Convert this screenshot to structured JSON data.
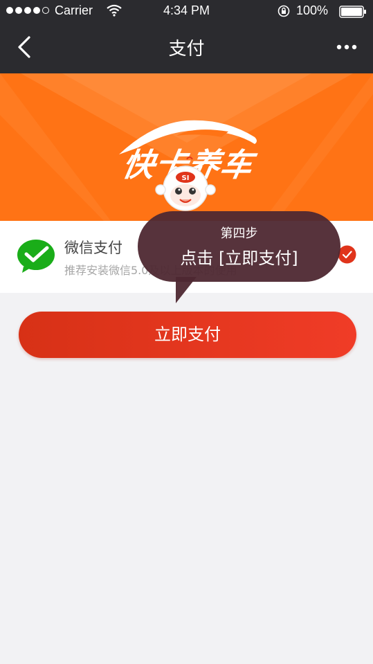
{
  "status_bar": {
    "carrier": "Carrier",
    "time": "4:34 PM",
    "battery": "100%"
  },
  "nav": {
    "title": "支付",
    "back_icon": "chevron-left-icon",
    "more_icon": "more-dots-icon"
  },
  "banner": {
    "brand": "快卡养车",
    "color": "#ff7315"
  },
  "payment": {
    "method_name": "微信支付",
    "method_desc": "推荐安装微信5.0及以上版本的使用",
    "selected": true,
    "icon": "wechat-pay-icon",
    "check_color": "#e0341b"
  },
  "pay_button": {
    "label": "立即支付",
    "color": "#e5361c"
  },
  "tooltip": {
    "step": "第四步",
    "instruction": "点击 [立即支付]"
  },
  "mascot": {
    "badge": "SI"
  }
}
